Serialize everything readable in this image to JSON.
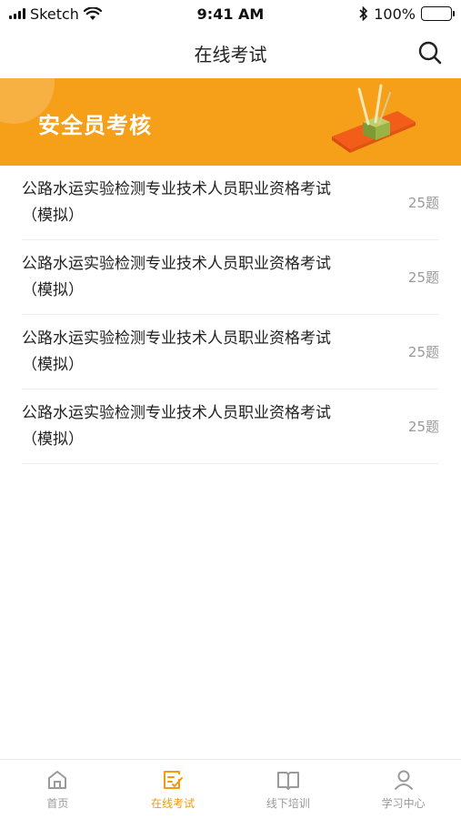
{
  "status_bar": {
    "carrier": "Sketch",
    "time": "9:41 AM",
    "battery": "100%"
  },
  "header": {
    "title": "在线考试",
    "search_icon": "search-icon"
  },
  "banner": {
    "title": "安全员考核",
    "background_color": "#f6a01a"
  },
  "exams": [
    {
      "title": "公路水运实验检测专业技术人员职业资格考试（模拟）",
      "count": "25题"
    },
    {
      "title": "公路水运实验检测专业技术人员职业资格考试（模拟）",
      "count": "25题"
    },
    {
      "title": "公路水运实验检测专业技术人员职业资格考试（模拟）",
      "count": "25题"
    },
    {
      "title": "公路水运实验检测专业技术人员职业资格考试（模拟）",
      "count": "25题"
    }
  ],
  "tabbar": {
    "active_color": "#f39a12",
    "items": [
      {
        "label": "首页",
        "icon": "home-icon",
        "active": false
      },
      {
        "label": "在线考试",
        "icon": "exam-icon",
        "active": true
      },
      {
        "label": "线下培训",
        "icon": "book-icon",
        "active": false
      },
      {
        "label": "学习中心",
        "icon": "user-icon",
        "active": false
      }
    ]
  }
}
